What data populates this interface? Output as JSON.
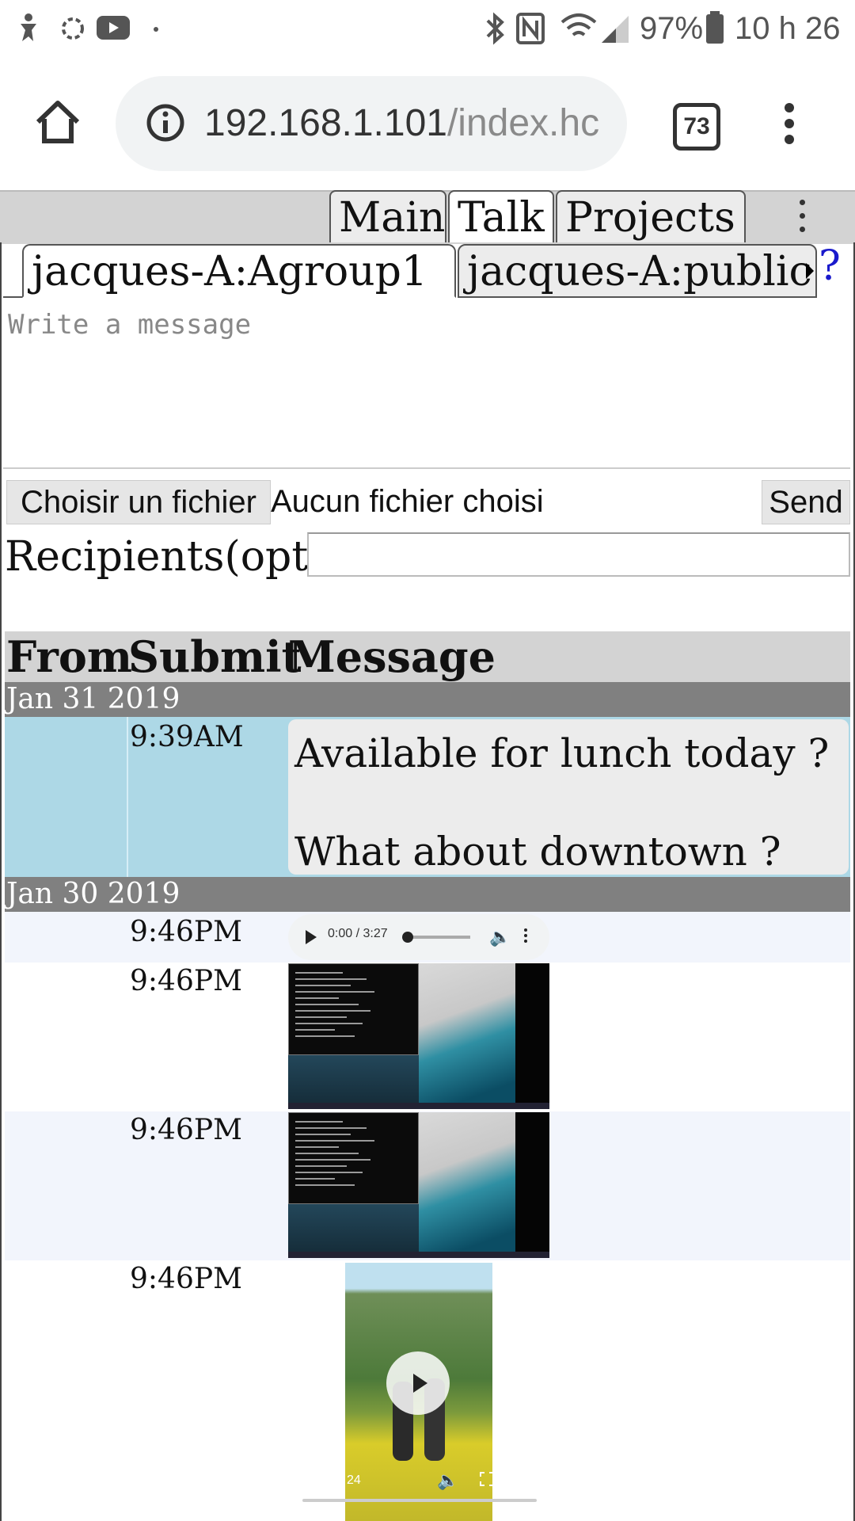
{
  "status_bar": {
    "battery": "97%",
    "time": "10 h 26"
  },
  "browser": {
    "url_host": "192.168.1.101",
    "url_path": "/index.hc",
    "tab_count": "73"
  },
  "app_nav": {
    "tabs": [
      "Main",
      "Talk",
      "Projects"
    ],
    "active": "Talk"
  },
  "conversation_tabs": {
    "tabs": [
      "jacques-A:Agroup1",
      "jacques-A:public"
    ],
    "help": "?"
  },
  "composer": {
    "placeholder": "Write a message",
    "file_button": "Choisir un fichier",
    "file_status": "Aucun fichier choisi",
    "send": "Send",
    "recipients_label": "Recipients(opt)"
  },
  "table": {
    "headers": [
      "From",
      "Submit",
      "Message"
    ],
    "groups": [
      {
        "date": "Jan 31 2019",
        "rows": [
          {
            "time": "9:39AM",
            "message_lines": [
              "Available for lunch today ?",
              "What about downtown ?"
            ]
          }
        ]
      },
      {
        "date": "Jan 30 2019",
        "rows": [
          {
            "time": "9:46PM",
            "attachment": "audio",
            "audio_time": "0:00 / 3:27"
          },
          {
            "time": "9:46PM",
            "attachment": "image"
          },
          {
            "time": "9:46PM",
            "attachment": "image"
          },
          {
            "time": "9:46PM",
            "attachment": "video",
            "video_time": "24"
          }
        ]
      }
    ]
  },
  "colors": {
    "highlight_row": "#add8e6",
    "date_band": "#808080",
    "header": "#d3d3d3",
    "alt_row": "#f2f5fc",
    "help_link": "#1a1acc"
  }
}
